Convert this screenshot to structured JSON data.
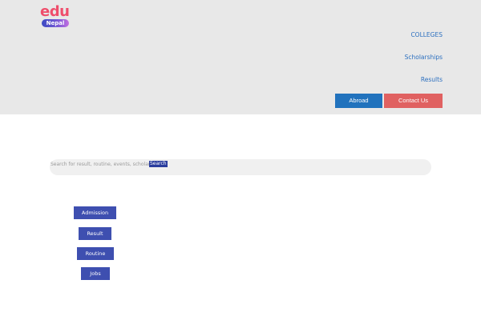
{
  "brand": {
    "top": "edu",
    "bottom": "Nepal"
  },
  "nav": {
    "colleges": "COLLEGES",
    "scholarships": "Scholarships",
    "results": "Results"
  },
  "actions": {
    "abroad": "Abroad",
    "contact": "Contact Us"
  },
  "search": {
    "placeholder": "Search for result, routine, events, scholarships",
    "button": "Search"
  },
  "categories": {
    "admission": "Admission",
    "result": "Result",
    "routine": "Routine",
    "jobs": "Jobs"
  },
  "colors": {
    "header_bg": "#e8e8e8",
    "nav_link": "#2b6fbf",
    "abroad_btn": "#2172bd",
    "contact_btn": "#e06161",
    "category_btn": "#3e4fb0",
    "logo_red": "#ef4d6b"
  }
}
